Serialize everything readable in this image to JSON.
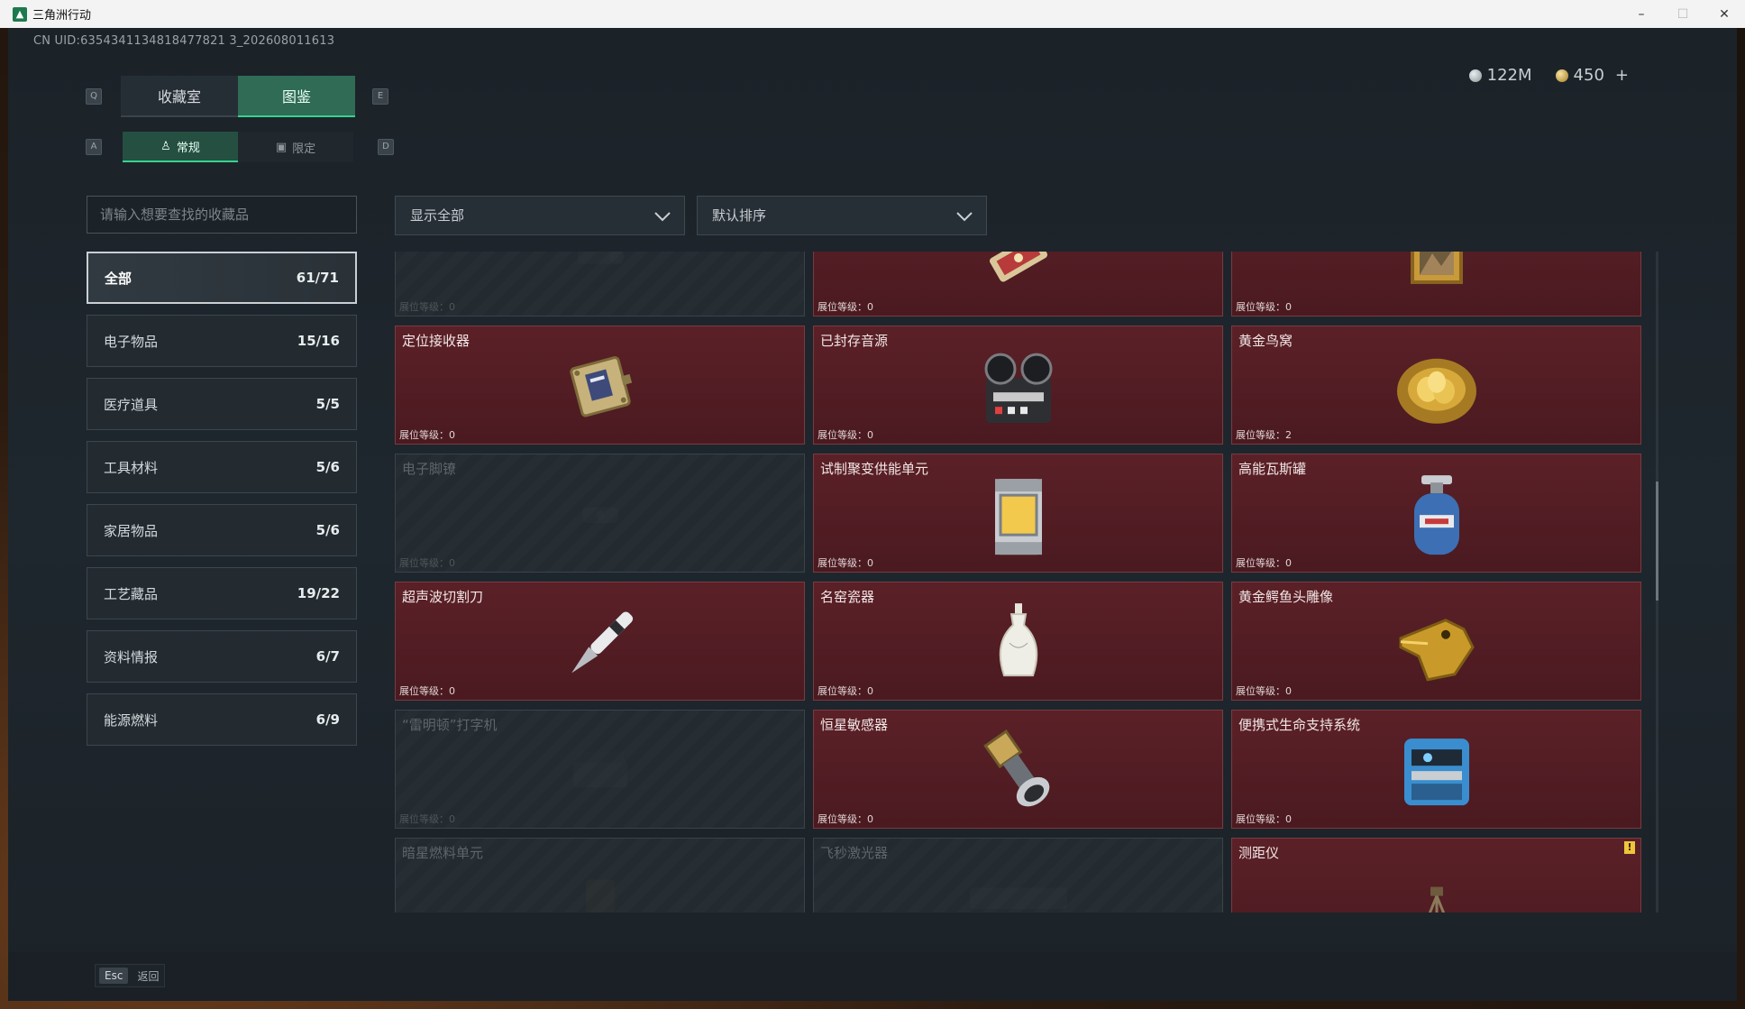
{
  "window": {
    "title": "三角洲行动",
    "minimize": "–",
    "maximize": "☐",
    "close": "✕"
  },
  "uid_text": "CN UID:6354341134818477821 3_202608011613",
  "currency": {
    "silver": "122M",
    "gold": "450",
    "add": "+"
  },
  "keys": {
    "tab_left": "Q",
    "tab_right": "E",
    "sub_left": "A",
    "sub_right": "D"
  },
  "tabs": [
    {
      "label": "收藏室"
    },
    {
      "label": "图鉴"
    }
  ],
  "subtabs": [
    {
      "label": "常规",
      "icon": "figure-icon"
    },
    {
      "label": "限定",
      "icon": "picture-icon"
    }
  ],
  "search": {
    "placeholder": "请输入想要查找的收藏品"
  },
  "filters": {
    "show": "显示全部",
    "sort": "默认排序"
  },
  "categories": [
    {
      "label": "全部",
      "count": "61/71"
    },
    {
      "label": "电子物品",
      "count": "15/16"
    },
    {
      "label": "医疗道具",
      "count": "5/5"
    },
    {
      "label": "工具材料",
      "count": "5/6"
    },
    {
      "label": "家居物品",
      "count": "5/6"
    },
    {
      "label": "工艺藏品",
      "count": "19/22"
    },
    {
      "label": "资料情报",
      "count": "6/7"
    },
    {
      "label": "能源燃料",
      "count": "6/9"
    }
  ],
  "level_prefix": "展位等级：",
  "items": [
    {
      "name": "",
      "level": "0",
      "owned": false,
      "icon": "device-icon"
    },
    {
      "name": "",
      "level": "0",
      "owned": true,
      "icon": "ornament-icon"
    },
    {
      "name": "",
      "level": "0",
      "owned": true,
      "icon": "painting-icon"
    },
    {
      "name": "定位接收器",
      "level": "0",
      "owned": true,
      "icon": "receiver-icon"
    },
    {
      "name": "已封存音源",
      "level": "0",
      "owned": true,
      "icon": "tape-recorder-icon"
    },
    {
      "name": "黄金鸟窝",
      "level": "2",
      "owned": true,
      "icon": "golden-nest-icon"
    },
    {
      "name": "电子脚镣",
      "level": "0",
      "owned": false,
      "icon": "shackle-icon"
    },
    {
      "name": "试制聚变供能单元",
      "level": "0",
      "owned": true,
      "icon": "fusion-unit-icon"
    },
    {
      "name": "高能瓦斯罐",
      "level": "0",
      "owned": true,
      "icon": "gas-tank-icon"
    },
    {
      "name": "超声波切割刀",
      "level": "0",
      "owned": true,
      "icon": "cutter-icon"
    },
    {
      "name": "名窑瓷器",
      "level": "0",
      "owned": true,
      "icon": "porcelain-vase-icon"
    },
    {
      "name": "黄金鳄鱼头雕像",
      "level": "0",
      "owned": true,
      "icon": "golden-crocodile-icon"
    },
    {
      "name": "“雷明顿”打字机",
      "level": "0",
      "owned": false,
      "icon": "typewriter-icon"
    },
    {
      "name": "恒星敏感器",
      "level": "0",
      "owned": true,
      "icon": "star-sensor-icon"
    },
    {
      "name": "便携式生命支持系统",
      "level": "0",
      "owned": true,
      "icon": "life-support-icon"
    },
    {
      "name": "暗星燃料单元",
      "level": "",
      "owned": false,
      "icon": "fuel-unit-icon"
    },
    {
      "name": "飞秒激光器",
      "level": "",
      "owned": false,
      "icon": "laser-icon"
    },
    {
      "name": "测距仪",
      "level": "",
      "owned": true,
      "icon": "rangefinder-icon",
      "badge": "!"
    }
  ],
  "footer": {
    "key": "Esc",
    "label": "返回"
  },
  "colors": {
    "accent_green": "#37d28f",
    "owned_card": "#5b2027",
    "badge_yellow": "#f0c43b"
  }
}
